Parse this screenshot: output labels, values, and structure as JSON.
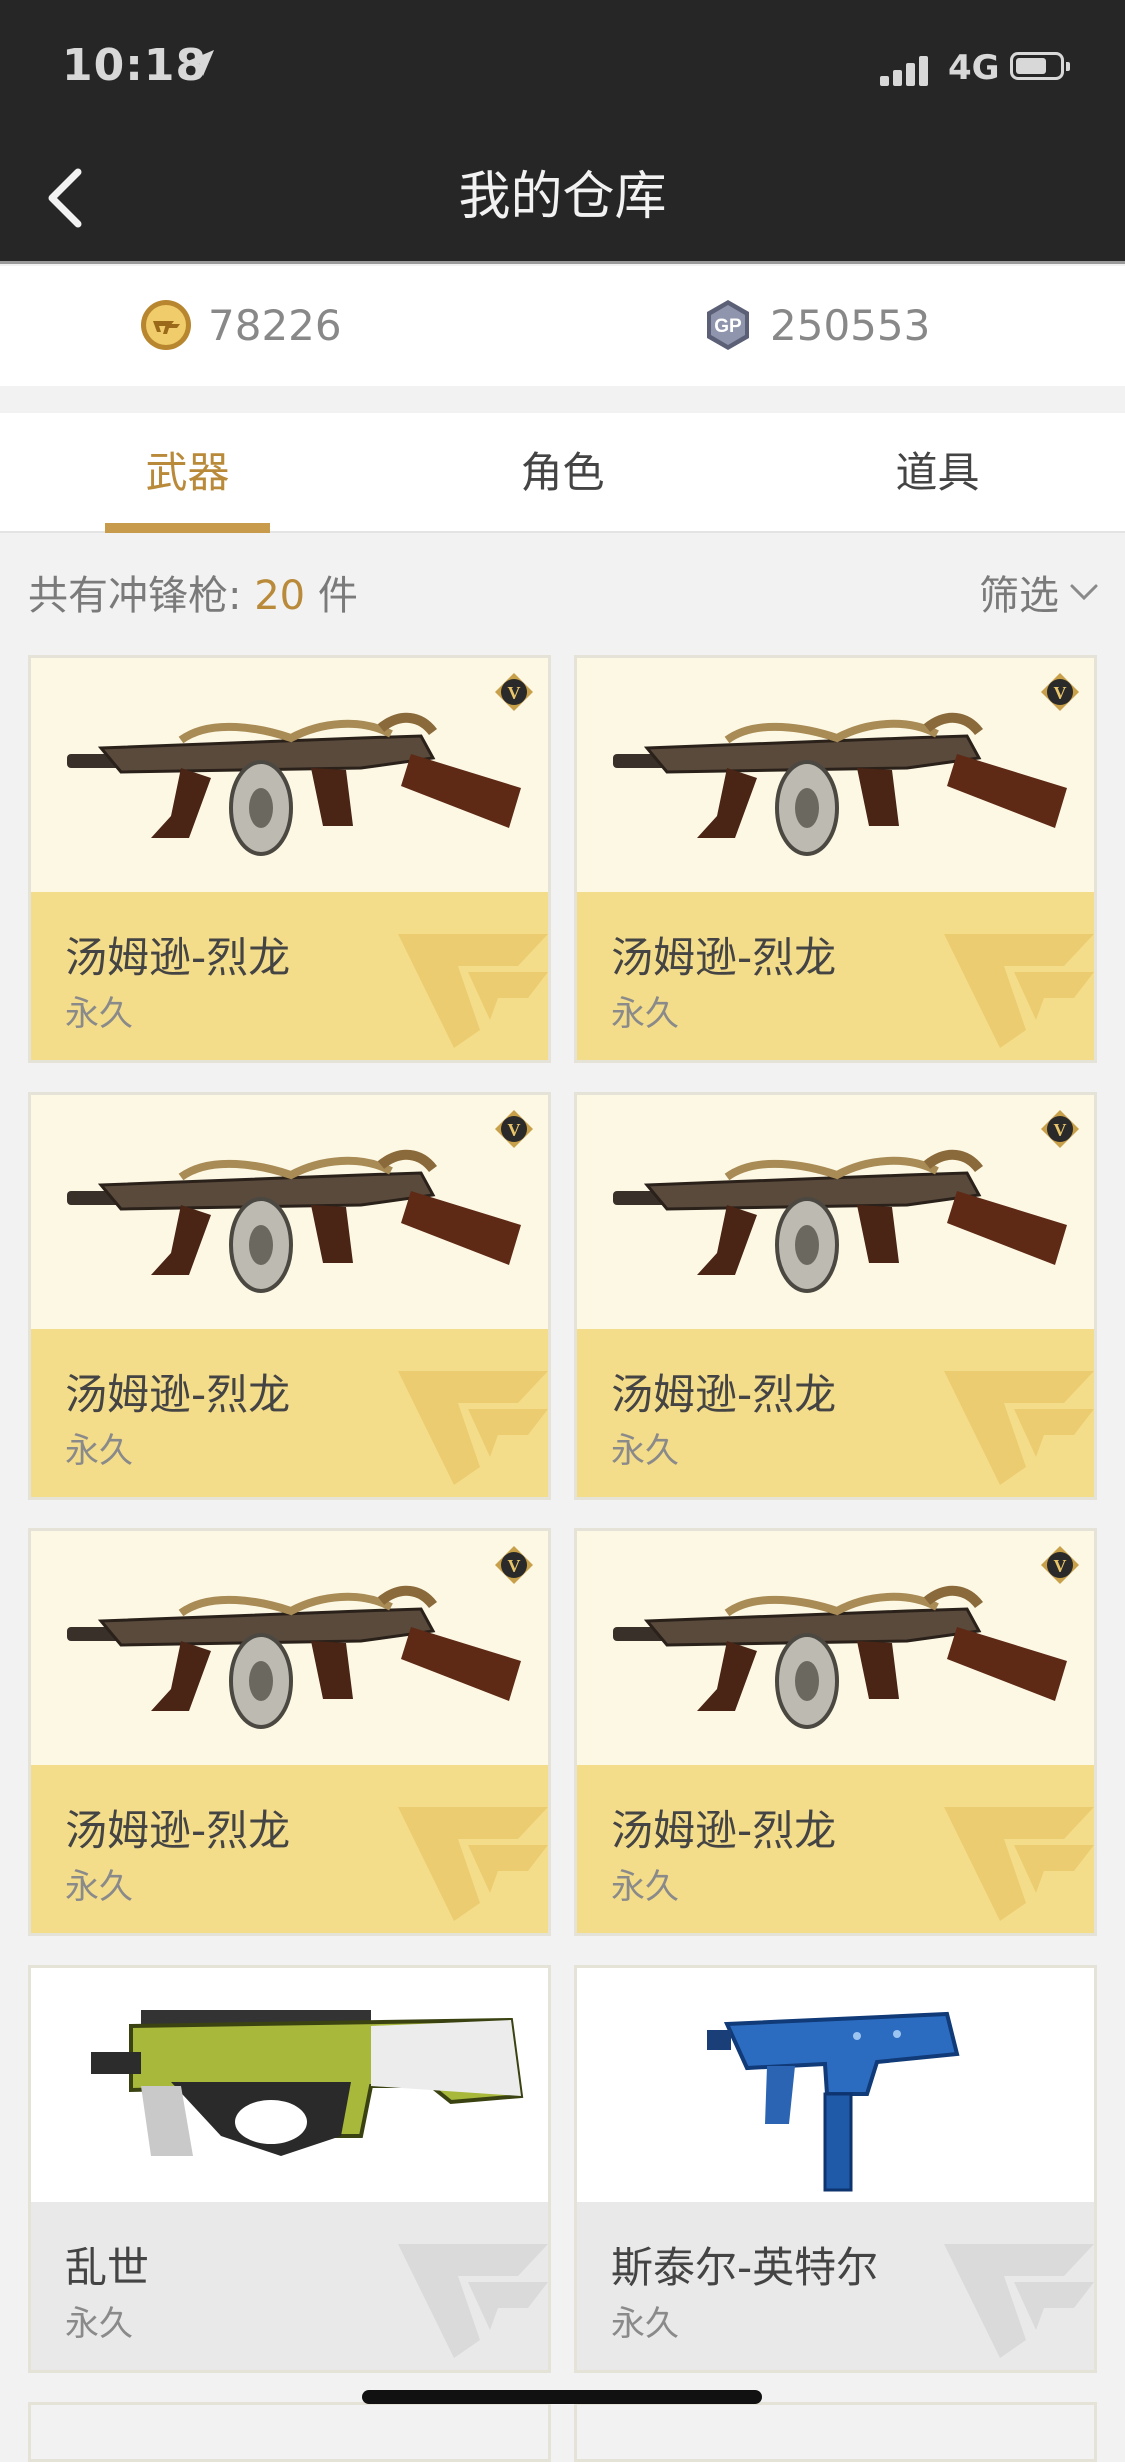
{
  "status_bar": {
    "time": "10:18",
    "carrier": "4G"
  },
  "header": {
    "title": "我的仓库"
  },
  "currency": [
    {
      "icon": "cf-coin-icon",
      "amount": "78226"
    },
    {
      "icon": "gp-coin-icon",
      "amount": "250553"
    }
  ],
  "tabs": [
    {
      "label": "武器",
      "active": true
    },
    {
      "label": "角色",
      "active": false
    },
    {
      "label": "道具",
      "active": false
    }
  ],
  "count": {
    "prefix": "共有冲锋枪: ",
    "value": "20",
    "unit": " 件"
  },
  "filter": {
    "label": "筛选"
  },
  "items": [
    {
      "name": "汤姆逊-烈龙",
      "duration": "永久",
      "tier": "gold",
      "badge": "V",
      "weapon": "tommy-gun"
    },
    {
      "name": "汤姆逊-烈龙",
      "duration": "永久",
      "tier": "gold",
      "badge": "V",
      "weapon": "tommy-gun"
    },
    {
      "name": "汤姆逊-烈龙",
      "duration": "永久",
      "tier": "gold",
      "badge": "V",
      "weapon": "tommy-gun"
    },
    {
      "name": "汤姆逊-烈龙",
      "duration": "永久",
      "tier": "gold",
      "badge": "V",
      "weapon": "tommy-gun"
    },
    {
      "name": "汤姆逊-烈龙",
      "duration": "永久",
      "tier": "gold",
      "badge": "V",
      "weapon": "tommy-gun"
    },
    {
      "name": "汤姆逊-烈龙",
      "duration": "永久",
      "tier": "gold",
      "badge": "V",
      "weapon": "tommy-gun"
    },
    {
      "name": "乱世",
      "duration": "永久",
      "tier": "grey",
      "weapon": "p90"
    },
    {
      "name": "斯泰尔-英特尔",
      "duration": "永久",
      "tier": "grey",
      "weapon": "tmp"
    }
  ],
  "colors": {
    "accent": "#b98a3a",
    "gold_card": "#f4dd8a",
    "header_bg": "#262626"
  }
}
